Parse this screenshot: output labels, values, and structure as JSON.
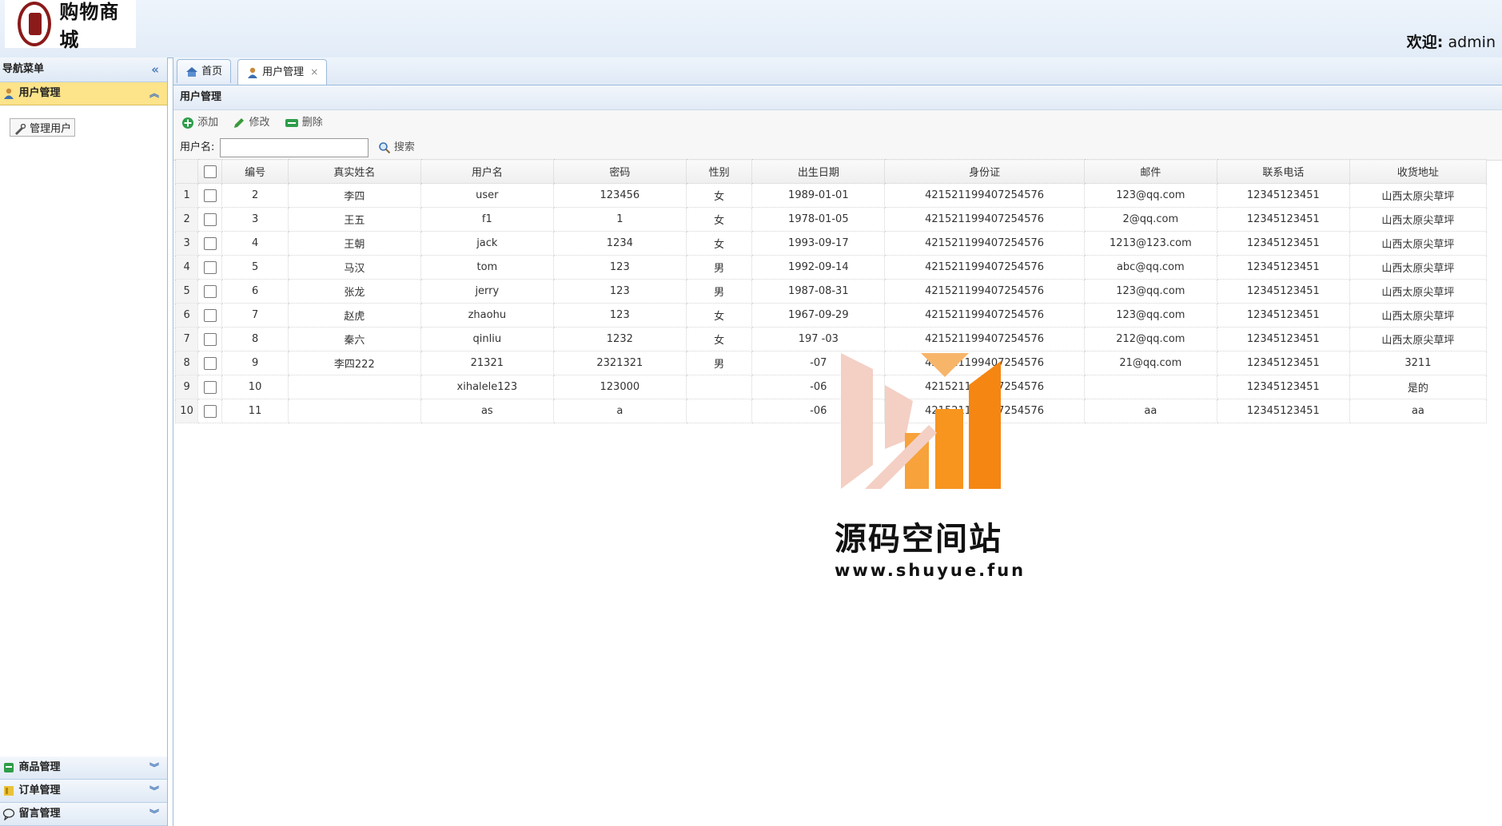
{
  "header": {
    "logo_text": "购物商城",
    "welcome_label": "欢迎:",
    "welcome_user": "admin"
  },
  "nav": {
    "title": "导航菜单",
    "panels": [
      {
        "label": "用户管理",
        "active": true,
        "items": [
          "管理用户"
        ]
      },
      {
        "label": "商品管理"
      },
      {
        "label": "订单管理"
      },
      {
        "label": "留言管理"
      }
    ]
  },
  "tabs": [
    {
      "label": "首页"
    },
    {
      "label": "用户管理"
    }
  ],
  "panel_title": "用户管理",
  "toolbar": {
    "add": "添加",
    "edit": "修改",
    "delete": "删除"
  },
  "search": {
    "label": "用户名:",
    "value": "",
    "button": "搜索"
  },
  "grid": {
    "columns": [
      "编号",
      "真实姓名",
      "用户名",
      "密码",
      "性别",
      "出生日期",
      "身份证",
      "邮件",
      "联系电话",
      "收货地址"
    ],
    "rows": [
      [
        "2",
        "李四",
        "user",
        "123456",
        "女",
        "1989-01-01",
        "421521199407254576",
        "123@qq.com",
        "12345123451",
        "山西太原尖草坪"
      ],
      [
        "3",
        "王五",
        "f1",
        "1",
        "女",
        "1978-01-05",
        "421521199407254576",
        "2@qq.com",
        "12345123451",
        "山西太原尖草坪"
      ],
      [
        "4",
        "王朝",
        "jack",
        "1234",
        "女",
        "1993-09-17",
        "421521199407254576",
        "1213@123.com",
        "12345123451",
        "山西太原尖草坪"
      ],
      [
        "5",
        "马汉",
        "tom",
        "123",
        "男",
        "1992-09-14",
        "421521199407254576",
        "abc@qq.com",
        "12345123451",
        "山西太原尖草坪"
      ],
      [
        "6",
        "张龙",
        "jerry",
        "123",
        "男",
        "1987-08-31",
        "421521199407254576",
        "123@qq.com",
        "12345123451",
        "山西太原尖草坪"
      ],
      [
        "7",
        "赵虎",
        "zhaohu",
        "123",
        "女",
        "1967-09-29",
        "421521199407254576",
        "123@qq.com",
        "12345123451",
        "山西太原尖草坪"
      ],
      [
        "8",
        "秦六",
        "qinliu",
        "1232",
        "女",
        "197 -03",
        "421521199407254576",
        "212@qq.com",
        "12345123451",
        "山西太原尖草坪"
      ],
      [
        "9",
        "李四222",
        "21321",
        "2321321",
        "男",
        "-07",
        "421521199407254576",
        "21@qq.com",
        "12345123451",
        "3211"
      ],
      [
        "10",
        "",
        "xihalele123",
        "123000",
        "",
        "-06",
        "421521199407254576",
        "",
        "12345123451",
        "是的"
      ],
      [
        "11",
        "",
        "as",
        "a",
        "",
        "-06",
        "421521199407254576",
        "aa",
        "12345123451",
        "aa"
      ]
    ]
  },
  "watermark": {
    "title": "源码空间站",
    "url": "www.shuyue.fun"
  },
  "colors": {
    "accent": "#fde38a",
    "border": "#9cbad9",
    "watermark_orange": "#f7901e",
    "watermark_pink": "#f4cfc4"
  }
}
